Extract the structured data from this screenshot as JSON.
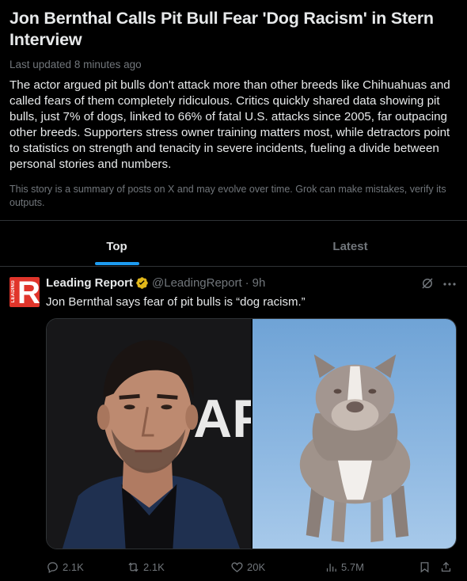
{
  "story": {
    "headline": "Jon Bernthal Calls Pit Bull Fear 'Dog Racism' in Stern Interview",
    "updated": "Last updated 8 minutes ago",
    "summary": "The actor argued pit bulls don't attack more than other breeds like Chihuahuas and called fears of them completely ridiculous. Critics quickly shared data showing pit bulls, just 7% of dogs, linked to 66% of fatal U.S. attacks since 2005, far outpacing other breeds. Supporters stress owner training matters most, while detractors point to statistics on strength and tenacity in severe incidents, fueling a divide between personal stories and numbers.",
    "disclaimer": "This story is a summary of posts on X and may evolve over time. Grok can make mistakes, verify its outputs."
  },
  "tabs": [
    {
      "label": "Top",
      "active": true
    },
    {
      "label": "Latest",
      "active": false
    }
  ],
  "post": {
    "author": "Leading Report",
    "avatar_letter": "R",
    "avatar_text": "LEADING",
    "handle": "@LeadingReport",
    "separator": "·",
    "time": "9h",
    "text": "Jon Bernthal says fear of pit bulls is “dog racism.”",
    "backdrop_letters": "AF",
    "icons": {
      "verified": "verified-badge-icon",
      "grok": "grok-icon",
      "more": "more-icon"
    },
    "actions": {
      "replies": "2.1K",
      "reposts": "2.1K",
      "likes": "20K",
      "views": "5.7M"
    }
  },
  "colors": {
    "background": "#000000",
    "text": "#e7e9ea",
    "muted": "#71767b",
    "accent": "#1d9bf0",
    "verified": "#e2b719",
    "avatar": "#e0352b"
  }
}
